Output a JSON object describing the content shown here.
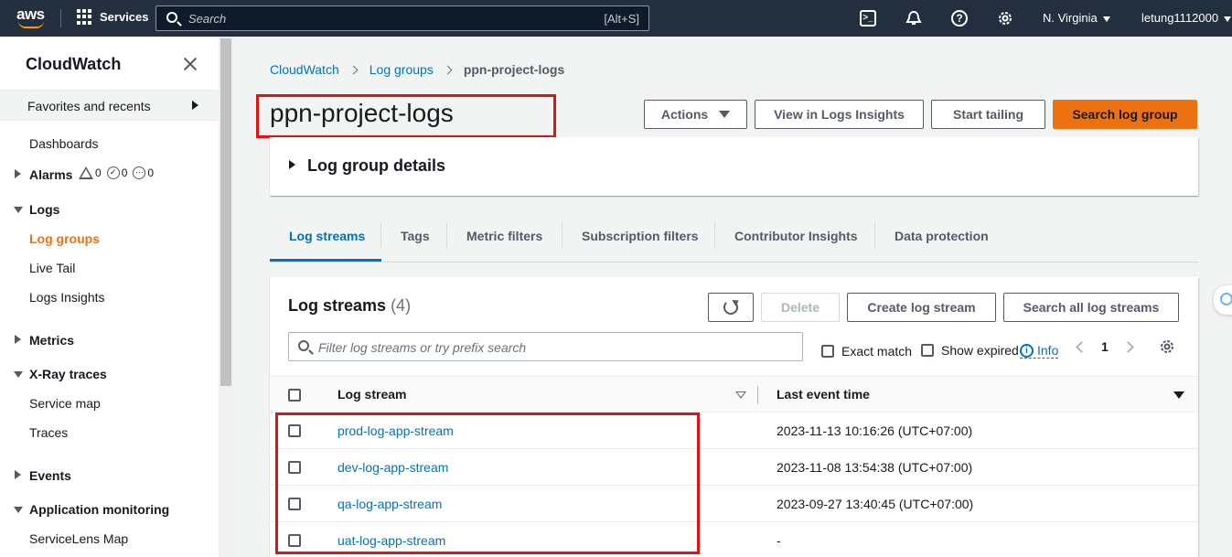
{
  "topnav": {
    "logo": "aws",
    "services_label": "Services",
    "search_placeholder": "Search",
    "search_shortcut": "[Alt+S]",
    "region": "N. Virginia",
    "account": "letung1112000",
    "icons": [
      "cloudshell-icon",
      "bell-icon",
      "help-icon",
      "gear-icon"
    ]
  },
  "sidebar": {
    "title": "CloudWatch",
    "favorites_label": "Favorites and recents",
    "dashboards": "Dashboards",
    "alarms": {
      "label": "Alarms",
      "alarm_count": "0",
      "ok_count": "0",
      "insufficient_count": "0"
    },
    "logs": {
      "label": "Logs",
      "items": [
        "Log groups",
        "Live Tail",
        "Logs Insights"
      ]
    },
    "metrics": "Metrics",
    "xray": {
      "label": "X-Ray traces",
      "items": [
        "Service map",
        "Traces"
      ]
    },
    "events": "Events",
    "appmon": {
      "label": "Application monitoring",
      "items": [
        "ServiceLens Map"
      ]
    }
  },
  "breadcrumb": [
    "CloudWatch",
    "Log groups",
    "ppn-project-logs"
  ],
  "page": {
    "title": "ppn-project-logs",
    "buttons": {
      "actions": "Actions",
      "insights": "View in Logs Insights",
      "tailing": "Start tailing",
      "search": "Search log group"
    },
    "details_label": "Log group details",
    "tabs": [
      "Log streams",
      "Tags",
      "Metric filters",
      "Subscription filters",
      "Contributor Insights",
      "Data protection"
    ]
  },
  "streams": {
    "title": "Log streams",
    "count": "(4)",
    "buttons": {
      "delete": "Delete",
      "create": "Create log stream",
      "search_all": "Search all log streams"
    },
    "filter_placeholder": "Filter log streams or try prefix search",
    "exact_match": "Exact match",
    "show_expired": "Show expired",
    "info": "Info",
    "page": "1",
    "columns": {
      "stream": "Log stream",
      "last_event": "Last event time"
    },
    "rows": [
      {
        "name": "prod-log-app-stream",
        "time": "2023-11-13 10:16:26 (UTC+07:00)"
      },
      {
        "name": "dev-log-app-stream",
        "time": "2023-11-08 13:54:38 (UTC+07:00)"
      },
      {
        "name": "qa-log-app-stream",
        "time": "2023-09-27 13:40:45 (UTC+07:00)"
      },
      {
        "name": "uat-log-app-stream",
        "time": "-"
      }
    ]
  },
  "colors": {
    "nav_bg": "#232f3e",
    "accent": "#ec7211",
    "link": "#0073bb",
    "highlight": "#d91515"
  }
}
